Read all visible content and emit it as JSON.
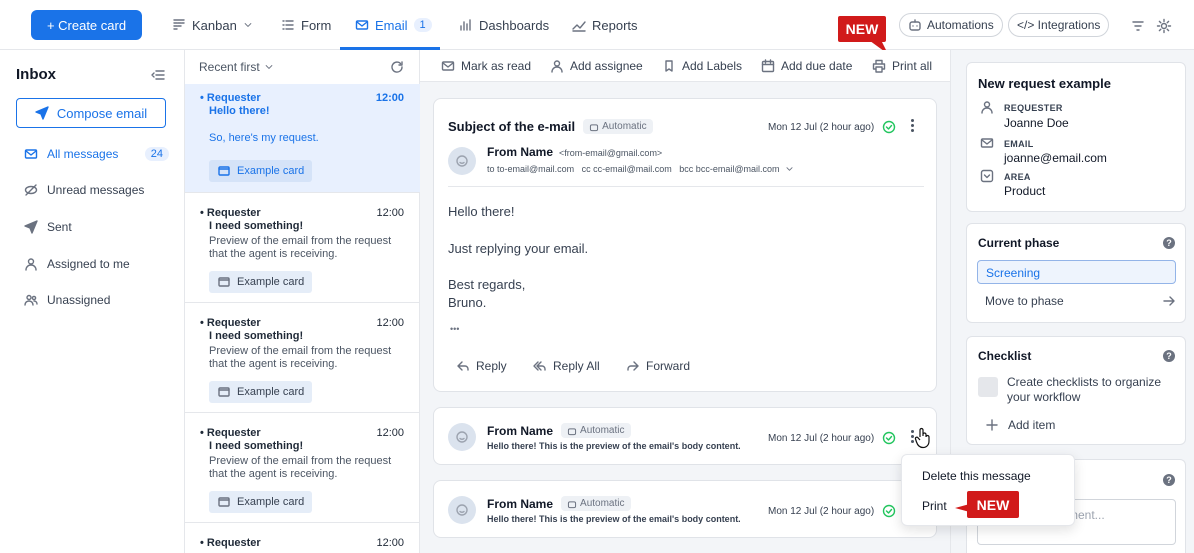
{
  "topbar": {
    "create_card": "+ Create card",
    "nav": [
      {
        "label": "Kanban",
        "icon": "kanban-icon"
      },
      {
        "label": "Form",
        "icon": "form-icon"
      },
      {
        "label": "Email",
        "icon": "email-icon",
        "badge": "1"
      },
      {
        "label": "Dashboards",
        "icon": "dashboards-icon"
      },
      {
        "label": "Reports",
        "icon": "reports-icon"
      }
    ],
    "automations": "Automations",
    "integrations": "</> Integrations",
    "new_tag": "NEW"
  },
  "sidebar": {
    "title": "Inbox",
    "compose": "Compose email",
    "items": [
      {
        "label": "All messages",
        "count": "24"
      },
      {
        "label": "Unread messages"
      },
      {
        "label": "Sent"
      },
      {
        "label": "Assigned to me"
      },
      {
        "label": "Unassigned"
      }
    ]
  },
  "list": {
    "sort": "Recent first",
    "messages": [
      {
        "from": "• Requester",
        "time": "12:00",
        "subject": "Hello there!",
        "preview": "So, here's my request.",
        "card": "Example card"
      },
      {
        "from": "• Requester",
        "time": "12:00",
        "subject": "I need something!",
        "preview": "Preview of the email from the request that the agent is receiving.",
        "card": "Example card"
      },
      {
        "from": "• Requester",
        "time": "12:00",
        "subject": "I need something!",
        "preview": "Preview of the email from the request that the agent is receiving.",
        "card": "Example card"
      },
      {
        "from": "• Requester",
        "time": "12:00",
        "subject": "I need something!",
        "preview": "Preview of the email from the request that the agent is receiving.",
        "card": "Example card"
      },
      {
        "from": "• Requester",
        "time": "12:00"
      }
    ]
  },
  "toolbar": {
    "mark_read": "Mark as read",
    "add_assignee": "Add assignee",
    "add_labels": "Add Labels",
    "add_due": "Add due date",
    "print_all": "Print all"
  },
  "email": {
    "subject": "Subject of the e-mail",
    "auto_chip": "Automatic",
    "date": "Mon 12 Jul (2 hour ago)",
    "from_name": "From Name",
    "from_addr": "<from-email@gmail.com>",
    "recipients": "to to-email@mail.com   cc cc-email@mail.com   bcc bcc-email@mail.com",
    "body": [
      "Hello there!",
      "Just replying your email.",
      "Best regards,",
      "Bruno."
    ],
    "ellipsis": "•••",
    "reply": "Reply",
    "reply_all": "Reply All",
    "forward": "Forward"
  },
  "collapsed": [
    {
      "from_name": "From Name",
      "auto_chip": "Automatic",
      "preview": "Hello there! This is the preview of the email's body content.",
      "date": "Mon 12 Jul (2 hour ago)"
    },
    {
      "from_name": "From Name",
      "auto_chip": "Automatic",
      "preview": "Hello there! This is the preview of the email's body content.",
      "date": "Mon 12 Jul (2 hour ago)"
    }
  ],
  "dropdown": {
    "delete": "Delete this message",
    "print": "Print",
    "new_tag": "NEW"
  },
  "right": {
    "request_title": "New request example",
    "fields": [
      {
        "label": "REQUESTER",
        "value": "Joanne Doe"
      },
      {
        "label": "EMAIL",
        "value": "joanne@email.com"
      },
      {
        "label": "AREA",
        "value": "Product"
      }
    ],
    "phase_title": "Current phase",
    "phase_value": "Screening",
    "move_phase": "Move to phase",
    "checklist_title": "Checklist",
    "checklist_text": "Create checklists to organize your workflow",
    "add_item": "Add item",
    "comment_placeholder": "ment..."
  },
  "colors": {
    "accent": "#1a73e8",
    "new_tag": "#d11a1a",
    "success": "#22c55e"
  }
}
